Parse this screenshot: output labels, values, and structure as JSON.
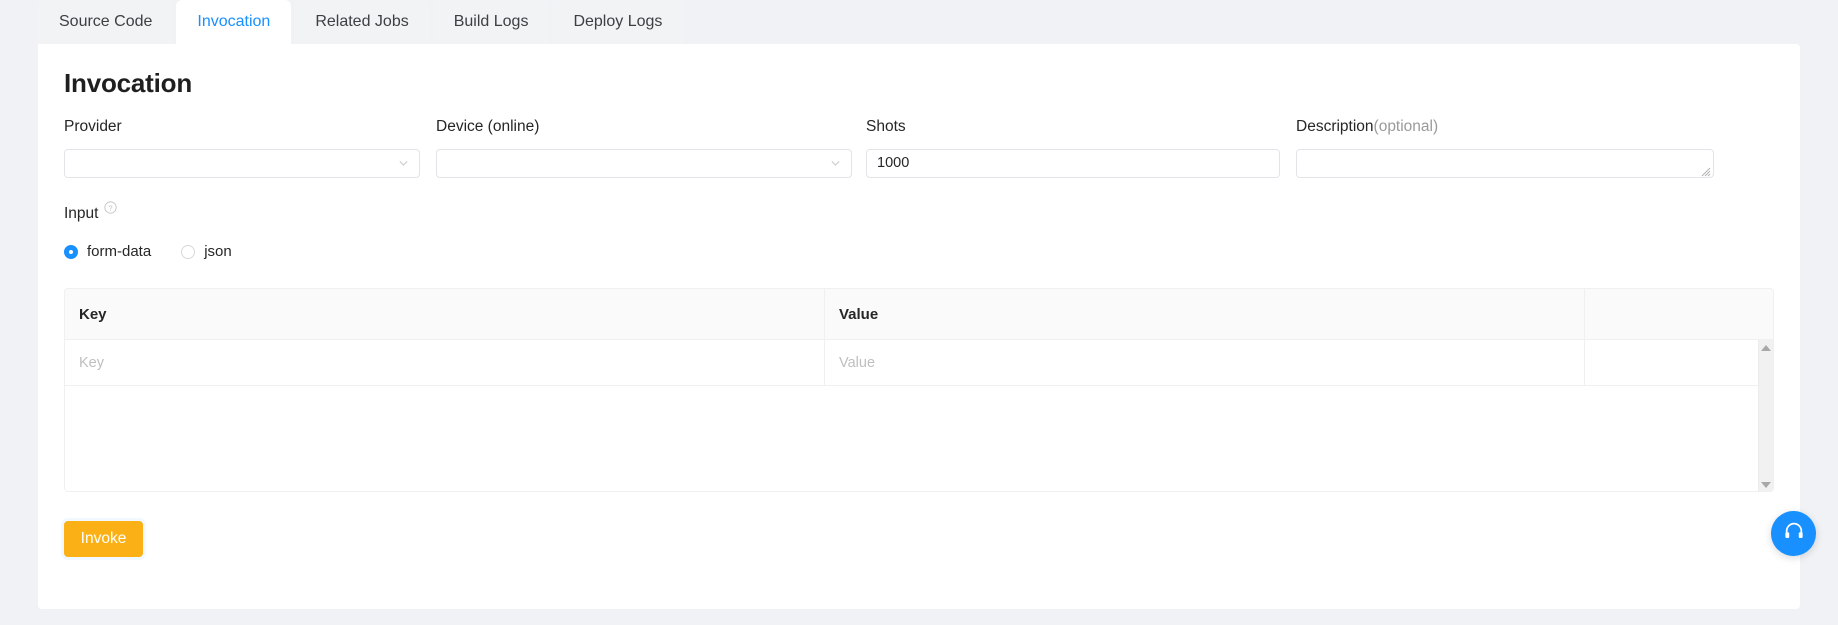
{
  "tabs": [
    {
      "label": "Source Code",
      "active": false
    },
    {
      "label": "Invocation",
      "active": true
    },
    {
      "label": "Related Jobs",
      "active": false
    },
    {
      "label": "Build Logs",
      "active": false
    },
    {
      "label": "Deploy Logs",
      "active": false
    }
  ],
  "page": {
    "title": "Invocation"
  },
  "form": {
    "provider": {
      "label": "Provider",
      "value": "",
      "placeholder": ""
    },
    "device": {
      "label": "Device (online)",
      "value": "",
      "placeholder": ""
    },
    "shots": {
      "label": "Shots",
      "value": "1000",
      "placeholder": ""
    },
    "description": {
      "label": "Description",
      "label_suffix": "(optional)",
      "value": "",
      "placeholder": ""
    }
  },
  "input_section": {
    "label": "Input",
    "help_icon": "question-circle-icon",
    "options": [
      {
        "label": "form-data",
        "checked": true
      },
      {
        "label": "json",
        "checked": false
      }
    ]
  },
  "table": {
    "headers": [
      "Key",
      "Value",
      ""
    ],
    "rows": [
      {
        "key_placeholder": "Key",
        "value_placeholder": "Value",
        "action": ""
      }
    ],
    "scrollbar": {
      "up_icon": "triangle-up-icon",
      "down_icon": "triangle-down-icon"
    }
  },
  "actions": {
    "invoke_label": "Invoke"
  },
  "support": {
    "icon": "headset-icon"
  },
  "colors": {
    "accent_blue": "#1890ff",
    "invoke_orange": "#fbb115",
    "page_bg": "#f0f2f5",
    "card_bg": "#ffffff",
    "border": "#f0f0f0",
    "placeholder": "#bfbfbf"
  }
}
